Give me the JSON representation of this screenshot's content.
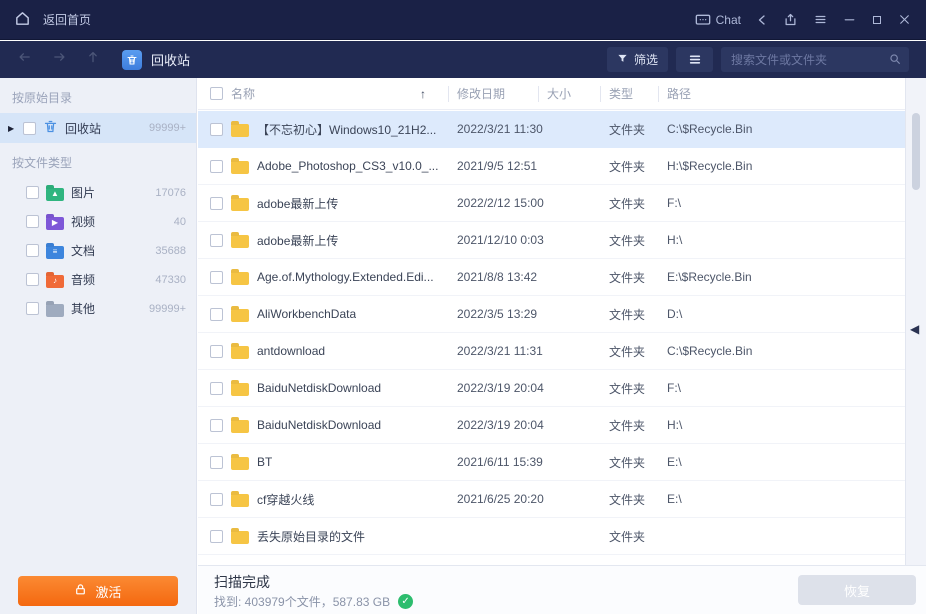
{
  "window": {
    "title_bar": {
      "home_label": "返回首页",
      "chat_label": "Chat"
    },
    "toolbar": {
      "location_label": "回收站",
      "filter_label": "筛选",
      "search_placeholder": "搜索文件或文件夹"
    }
  },
  "sidebar": {
    "section_directory": "按原始目录",
    "directory_items": [
      {
        "label": "回收站",
        "count": "99999+",
        "selected": true
      }
    ],
    "section_type": "按文件类型",
    "type_items": [
      {
        "label": "图片",
        "count": "17076",
        "color": "#2fb57f",
        "glyph": "▲"
      },
      {
        "label": "视频",
        "count": "40",
        "color": "#7e57d8",
        "glyph": "▶"
      },
      {
        "label": "文档",
        "count": "35688",
        "color": "#3d85dd",
        "glyph": "≡"
      },
      {
        "label": "音频",
        "count": "47330",
        "color": "#f06a38",
        "glyph": "♪"
      },
      {
        "label": "其他",
        "count": "99999+",
        "color": "#9fabbf",
        "glyph": ""
      }
    ],
    "activate_label": "激活"
  },
  "table": {
    "columns": [
      "名称",
      "修改日期",
      "大小",
      "类型",
      "路径"
    ],
    "sort_arrow": "↑",
    "rows": [
      {
        "name": "【不忘初心】Windows10_21H2...",
        "date": "2022/3/21 11:30",
        "size": "",
        "type": "文件夹",
        "path": "C:\\$Recycle.Bin",
        "selected": true
      },
      {
        "name": "Adobe_Photoshop_CS3_v10.0_...",
        "date": "2021/9/5 12:51",
        "size": "",
        "type": "文件夹",
        "path": "H:\\$Recycle.Bin"
      },
      {
        "name": "adobe最新上传",
        "date": "2022/2/12 15:00",
        "size": "",
        "type": "文件夹",
        "path": "F:\\"
      },
      {
        "name": "adobe最新上传",
        "date": "2021/12/10 0:03",
        "size": "",
        "type": "文件夹",
        "path": "H:\\"
      },
      {
        "name": "Age.of.Mythology.Extended.Edi...",
        "date": "2021/8/8 13:42",
        "size": "",
        "type": "文件夹",
        "path": "E:\\$Recycle.Bin"
      },
      {
        "name": "AliWorkbenchData",
        "date": "2022/3/5 13:29",
        "size": "",
        "type": "文件夹",
        "path": "D:\\"
      },
      {
        "name": "antdownload",
        "date": "2022/3/21 11:31",
        "size": "",
        "type": "文件夹",
        "path": "C:\\$Recycle.Bin"
      },
      {
        "name": "BaiduNetdiskDownload",
        "date": "2022/3/19 20:04",
        "size": "",
        "type": "文件夹",
        "path": "F:\\"
      },
      {
        "name": "BaiduNetdiskDownload",
        "date": "2022/3/19 20:04",
        "size": "",
        "type": "文件夹",
        "path": "H:\\"
      },
      {
        "name": "BT",
        "date": "2021/6/11 15:39",
        "size": "",
        "type": "文件夹",
        "path": "E:\\"
      },
      {
        "name": "cf穿越火线",
        "date": "2021/6/25 20:20",
        "size": "",
        "type": "文件夹",
        "path": "E:\\"
      },
      {
        "name": "丢失原始目录的文件",
        "date": "",
        "size": "",
        "type": "文件夹",
        "path": ""
      },
      {
        "name": "",
        "date": "",
        "size": "",
        "type": "",
        "path": "",
        "partial": true
      }
    ]
  },
  "status": {
    "title": "扫描完成",
    "detail": "找到: 403979个文件，587.83 GB",
    "recover_label": "恢复"
  }
}
